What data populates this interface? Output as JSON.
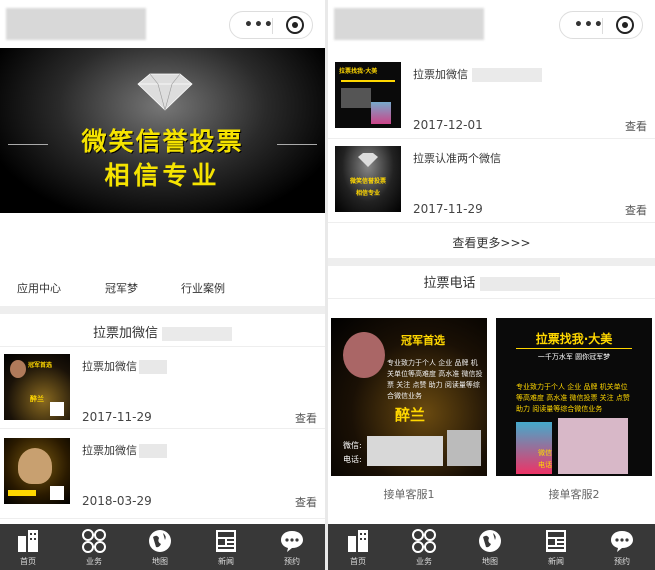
{
  "left": {
    "banner": {
      "line1": "微笑信誉投票",
      "line2": "相信专业"
    },
    "nav": [
      "应用中心",
      "冠军梦",
      "行业案例"
    ],
    "section_title": "拉票加微信",
    "items": [
      {
        "title": "拉票加微信",
        "date": "2017-11-29",
        "view": "查看",
        "thumb_top": "冠军首选",
        "thumb_name": "醉兰"
      },
      {
        "title": "拉票加微信",
        "date": "2018-03-29",
        "view": "查看",
        "thumb_top": "拉票找我·大美",
        "thumb_name": ""
      }
    ]
  },
  "right": {
    "items": [
      {
        "title": "拉票加微信",
        "date": "2017-12-01",
        "view": "查看",
        "thumb_top": "拉票找我·大美",
        "thumb_name": ""
      },
      {
        "title": "拉票认准两个微信",
        "date": "2017-11-29",
        "view": "查看",
        "thumb_top": "微笑信誉投票",
        "thumb_name": "相信专业"
      }
    ],
    "more": "查看更多>>>",
    "phone_title": "拉票电话",
    "cards": [
      {
        "label": "接单客服1",
        "head": "冠军首选",
        "text": "专业致力于个人 企业 品牌 机关单位等高难度 高水准 微信投票 关注 点赞 助力 阅读量等综合微信业务",
        "name": "醉兰",
        "wechat_label": "微信:",
        "phone_label": "电话:"
      },
      {
        "label": "接单客服2",
        "head": "拉票找我·大美",
        "sub": "一千万水军  圆你冠军梦",
        "text": "专业致力于个人 企业 品牌 机关单位等高难度 高水准 微信投票 关注 点赞 助力 阅读量等综合微信业务",
        "wechat_label": "微信",
        "phone_label": "电话"
      }
    ]
  },
  "tabbar": [
    "首页",
    "业务",
    "地图",
    "新闻",
    "预约"
  ],
  "tab_icons": [
    "building-icon",
    "grid-icon",
    "globe-icon",
    "news-icon",
    "chat-icon"
  ],
  "colors": {
    "banner_text": "#f5e300",
    "tabbar_bg": "#383838",
    "card_bg": "#111111"
  }
}
